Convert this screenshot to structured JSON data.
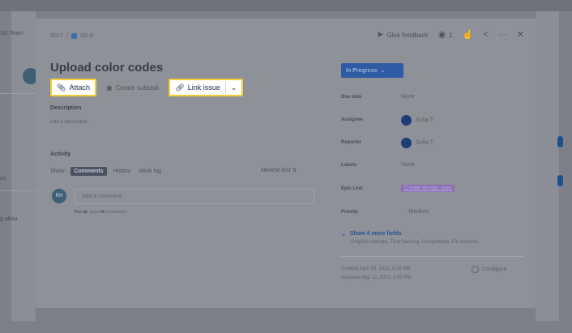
{
  "background": {
    "left_labels": [
      "SD Team",
      "ns",
      "g abou"
    ]
  },
  "breadcrumb": {
    "parent": "SD-7",
    "separator": "/",
    "issue": "SD-8"
  },
  "top_actions": {
    "feedback_label": "Give feedback",
    "watch_count": "1",
    "feedback_icon": "megaphone-icon",
    "watch_icon": "eye-icon",
    "like_icon": "thumbs-up-icon",
    "share_icon": "share-icon",
    "more_icon": "more-icon",
    "close_icon": "close-icon"
  },
  "issue": {
    "title": "Upload color codes"
  },
  "toolbar": {
    "attach_label": "Attach",
    "subtask_label": "Create subtask",
    "link_label": "Link issue",
    "highlight_color": "#f2cd35"
  },
  "description": {
    "heading": "Description",
    "placeholder": "Add a description..."
  },
  "activity": {
    "heading": "Activity",
    "show_label": "Show:",
    "tabs": [
      "Comments",
      "History",
      "Work log"
    ],
    "sort_label": "Newest first ⇅",
    "avatar_initials": "RH",
    "comment_placeholder": "Add a comment...",
    "protip_prefix": "Pro tip:",
    "protip_key": "M",
    "protip_suffix": "to comment",
    "protip_press": "press"
  },
  "details": {
    "status": "In Progress",
    "status_color": "#2f5aa4",
    "fields": [
      {
        "label": "Due date",
        "value": "None"
      },
      {
        "label": "Assignee",
        "value": "Sofia T"
      },
      {
        "label": "Reporter",
        "value": "Sofia T"
      },
      {
        "label": "Labels",
        "value": "None"
      },
      {
        "label": "Epic Link",
        "value": "Create design spec"
      },
      {
        "label": "Priority",
        "value": "Medium"
      }
    ],
    "more_fields_label": "Show 4 more fields",
    "more_fields_sub": "Original estimate, Time tracking, Components, Fix versions",
    "created": "Created April 28, 2021, 6:16 PM",
    "updated": "Updated May 12, 2021, 3:00 PM",
    "configure_label": "Configure"
  }
}
